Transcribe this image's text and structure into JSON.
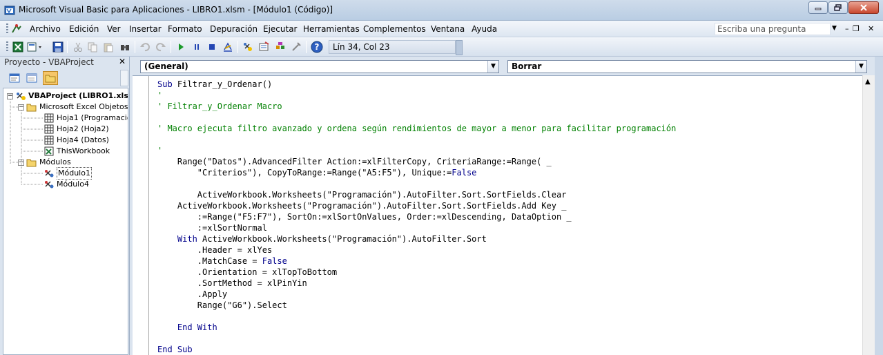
{
  "window": {
    "title": "Microsoft Visual Basic para Aplicaciones - LIBRO1.xlsm - [Módulo1 (Código)]"
  },
  "menu": {
    "items": [
      "Archivo",
      "Edición",
      "Ver",
      "Insertar",
      "Formato",
      "Depuración",
      "Ejecutar",
      "Herramientas",
      "Complementos",
      "Ventana",
      "Ayuda"
    ],
    "ask_placeholder": "Escriba una pregunta"
  },
  "toolbar": {
    "position": "Lín 34, Col 23"
  },
  "project": {
    "title": "Proyecto - VBAProject",
    "tree": {
      "root": "VBAProject (LIBRO1.xlsm",
      "excel_objects": "Microsoft Excel Objetos",
      "sheets": [
        "Hoja1 (Programació",
        "Hoja2 (Hoja2)",
        "Hoja4 (Datos)"
      ],
      "workbook": "ThisWorkbook",
      "modules_folder": "Módulos",
      "modules": [
        "Módulo1",
        "Módulo4"
      ]
    }
  },
  "editor": {
    "object_combo": "(General)",
    "procedure_combo": "Borrar",
    "lines": [
      {
        "kind": "mixed",
        "parts": [
          {
            "k": "kw",
            "t": "Sub"
          },
          {
            "k": "tx",
            "t": " Filtrar_y_Ordenar()"
          }
        ]
      },
      {
        "kind": "comment",
        "text": "'"
      },
      {
        "kind": "comment",
        "text": "' Filtrar_y_Ordenar Macro"
      },
      {
        "kind": "text",
        "text": ""
      },
      {
        "kind": "comment",
        "text": "' Macro ejecuta filtro avanzado y ordena según rendimientos de mayor a menor para facilitar programación"
      },
      {
        "kind": "text",
        "text": ""
      },
      {
        "kind": "comment",
        "text": "'"
      },
      {
        "kind": "text",
        "text": "    Range(\"Datos\").AdvancedFilter Action:=xlFilterCopy, CriteriaRange:=Range( _"
      },
      {
        "kind": "mixed",
        "parts": [
          {
            "k": "tx",
            "t": "        \"Criterios\"), CopyToRange:=Range(\"A5:F5\"), Unique:="
          },
          {
            "k": "kw",
            "t": "False"
          }
        ]
      },
      {
        "kind": "text",
        "text": ""
      },
      {
        "kind": "text",
        "text": "        ActiveWorkbook.Worksheets(\"Programación\").AutoFilter.Sort.SortFields.Clear"
      },
      {
        "kind": "text",
        "text": "    ActiveWorkbook.Worksheets(\"Programación\").AutoFilter.Sort.SortFields.Add Key _"
      },
      {
        "kind": "text",
        "text": "        :=Range(\"F5:F7\"), SortOn:=xlSortOnValues, Order:=xlDescending, DataOption _"
      },
      {
        "kind": "text",
        "text": "        :=xlSortNormal"
      },
      {
        "kind": "mixed",
        "parts": [
          {
            "k": "tx",
            "t": "    "
          },
          {
            "k": "kw",
            "t": "With"
          },
          {
            "k": "tx",
            "t": " ActiveWorkbook.Worksheets(\"Programación\").AutoFilter.Sort"
          }
        ]
      },
      {
        "kind": "text",
        "text": "        .Header = xlYes"
      },
      {
        "kind": "mixed",
        "parts": [
          {
            "k": "tx",
            "t": "        .MatchCase = "
          },
          {
            "k": "kw",
            "t": "False"
          }
        ]
      },
      {
        "kind": "text",
        "text": "        .Orientation = xlTopToBottom"
      },
      {
        "kind": "text",
        "text": "        .SortMethod = xlPinYin"
      },
      {
        "kind": "text",
        "text": "        .Apply"
      },
      {
        "kind": "text",
        "text": "        Range(\"G6\").Select"
      },
      {
        "kind": "text",
        "text": ""
      },
      {
        "kind": "mixed",
        "parts": [
          {
            "k": "tx",
            "t": "    "
          },
          {
            "k": "kw",
            "t": "End With"
          }
        ]
      },
      {
        "kind": "text",
        "text": ""
      },
      {
        "kind": "mixed",
        "parts": [
          {
            "k": "kw",
            "t": "End Sub"
          }
        ]
      }
    ]
  },
  "colors": {
    "comment": "#008000",
    "keyword": "#00008b",
    "chrome": "#dbe4ef"
  },
  "icons": [
    "excel-icon",
    "insert-module-icon",
    "save-icon",
    "cut-icon",
    "copy-icon",
    "paste-icon",
    "find-icon",
    "undo-icon",
    "redo-icon",
    "run-icon",
    "pause-icon",
    "stop-icon",
    "design-mode-icon",
    "project-explorer-icon",
    "properties-icon",
    "object-browser-icon",
    "toolbox-icon",
    "help-icon"
  ]
}
